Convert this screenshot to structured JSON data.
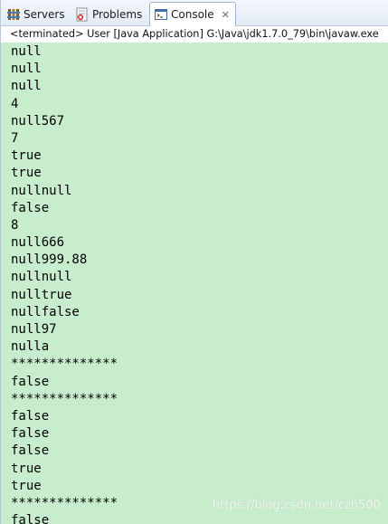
{
  "tabs": {
    "servers_label": "Servers",
    "problems_label": "Problems",
    "console_label": "Console"
  },
  "status_line": "<terminated> User [Java Application] G:\\Java\\jdk1.7.0_79\\bin\\javaw.exe",
  "console_lines": [
    "null",
    "null",
    "null",
    "4",
    "null567",
    "7",
    "true",
    "true",
    "nullnull",
    "false",
    "8",
    "null666",
    "null999.88",
    "nullnull",
    "nulltrue",
    "nullfalse",
    "null97",
    "nulla",
    "**************",
    "false",
    "**************",
    "false",
    "false",
    "false",
    "true",
    "true",
    "**************",
    "false"
  ],
  "watermark": "https://blog.csdn.net/czh500",
  "colors": {
    "console_background": "#c7edcc",
    "tabbar_background": "#e3ebf5"
  },
  "icons": {
    "servers": "servers-icon",
    "problems": "problems-icon",
    "console": "console-icon",
    "close": "close-icon"
  }
}
